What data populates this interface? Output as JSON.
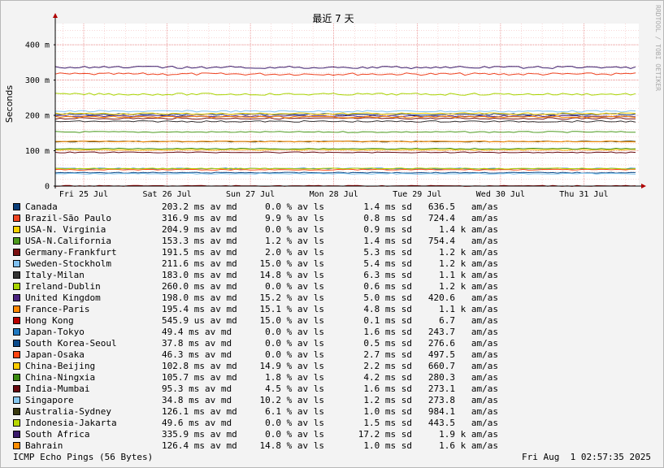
{
  "chart_data": {
    "type": "line",
    "title": "最近 7 天",
    "ylabel": "Seconds",
    "ylim": [
      0,
      0.46
    ],
    "y_ticks": [
      {
        "value": 0,
        "label": "0"
      },
      {
        "value": 0.1,
        "label": "100 m"
      },
      {
        "value": 0.2,
        "label": "200 m"
      },
      {
        "value": 0.3,
        "label": "300 m"
      },
      {
        "value": 0.4,
        "label": "400 m"
      }
    ],
    "x_ticks": [
      "Fri 25 Jul",
      "Sat 26 Jul",
      "Sun 27 Jul",
      "Mon 28 Jul",
      "Tue 29 Jul",
      "Wed 30 Jul",
      "Thu 31 Jul"
    ],
    "watermark": "RRDTOOL / TOBI OETIKER",
    "series": [
      {
        "name": "Canada",
        "color": "#0a3d78",
        "values": [
          0.203
        ]
      },
      {
        "name": "Brazil-São Paulo",
        "color": "#ee4422",
        "values": [
          0.317
        ]
      },
      {
        "name": "USA-N. Virginia",
        "color": "#f5d000",
        "values": [
          0.205
        ]
      },
      {
        "name": "USA-N.California",
        "color": "#4d9a1e",
        "values": [
          0.153
        ]
      },
      {
        "name": "Germany-Frankfurt",
        "color": "#7a0f0f",
        "values": [
          0.1915
        ]
      },
      {
        "name": "Sweden-Stockholm",
        "color": "#7fc0f0",
        "values": [
          0.2116
        ]
      },
      {
        "name": "Italy-Milan",
        "color": "#333333",
        "values": [
          0.183
        ]
      },
      {
        "name": "Ireland-Dublin",
        "color": "#a8d400",
        "values": [
          0.26
        ]
      },
      {
        "name": "United Kingdom",
        "color": "#4b2380",
        "values": [
          0.198
        ]
      },
      {
        "name": "France-Paris",
        "color": "#ff8800",
        "values": [
          0.1954
        ]
      },
      {
        "name": "Hong Kong",
        "color": "#b80000",
        "values": [
          0.000546
        ]
      },
      {
        "name": "Japan-Tokyo",
        "color": "#1f78c0",
        "values": [
          0.0494
        ]
      },
      {
        "name": "South Korea-Seoul",
        "color": "#0a4a8a",
        "values": [
          0.0378
        ]
      },
      {
        "name": "Japan-Osaka",
        "color": "#ff4411",
        "values": [
          0.0463
        ]
      },
      {
        "name": "China-Beijing",
        "color": "#ffcc00",
        "values": [
          0.1028
        ]
      },
      {
        "name": "China-Ningxia",
        "color": "#3a8a10",
        "values": [
          0.1057
        ]
      },
      {
        "name": "India-Mumbai",
        "color": "#6a0a10",
        "values": [
          0.0953
        ]
      },
      {
        "name": "Singapore",
        "color": "#88c8f0",
        "values": [
          0.0348
        ]
      },
      {
        "name": "Australia-Sydney",
        "color": "#3a3a10",
        "values": [
          0.1261
        ]
      },
      {
        "name": "Indonesia-Jakarta",
        "color": "#b8d800",
        "values": [
          0.0496
        ]
      },
      {
        "name": "South Africa",
        "color": "#3a1a6a",
        "values": [
          0.3359
        ]
      },
      {
        "name": "Bahrain",
        "color": "#ff8c00",
        "values": [
          0.1264
        ]
      }
    ]
  },
  "legend": [
    {
      "name": "Canada",
      "avg": "203.2 ms av md",
      "loss": "0.0 % av ls",
      "sd": "1.4 ms sd",
      "amas": "636.5   am/as"
    },
    {
      "name": "Brazil-São Paulo",
      "avg": "316.9 ms av md",
      "loss": "9.9 % av ls",
      "sd": "0.8 ms sd",
      "amas": "724.4   am/as"
    },
    {
      "name": "USA-N. Virginia",
      "avg": "204.9 ms av md",
      "loss": "0.0 % av ls",
      "sd": "0.9 ms sd",
      "amas": "1.4 k am/as"
    },
    {
      "name": "USA-N.California",
      "avg": "153.3 ms av md",
      "loss": "1.2 % av ls",
      "sd": "1.4 ms sd",
      "amas": "754.4   am/as"
    },
    {
      "name": "Germany-Frankfurt",
      "avg": "191.5 ms av md",
      "loss": "2.0 % av ls",
      "sd": "5.3 ms sd",
      "amas": "1.2 k am/as"
    },
    {
      "name": "Sweden-Stockholm",
      "avg": "211.6 ms av md",
      "loss": "15.0 % av ls",
      "sd": "5.4 ms sd",
      "amas": "1.2 k am/as"
    },
    {
      "name": "Italy-Milan",
      "avg": "183.0 ms av md",
      "loss": "14.8 % av ls",
      "sd": "6.3 ms sd",
      "amas": "1.1 k am/as"
    },
    {
      "name": "Ireland-Dublin",
      "avg": "260.0 ms av md",
      "loss": "0.0 % av ls",
      "sd": "0.6 ms sd",
      "amas": "1.2 k am/as"
    },
    {
      "name": "United Kingdom",
      "avg": "198.0 ms av md",
      "loss": "15.2 % av ls",
      "sd": "5.0 ms sd",
      "amas": "420.6   am/as"
    },
    {
      "name": "France-Paris",
      "avg": "195.4 ms av md",
      "loss": "15.1 % av ls",
      "sd": "4.8 ms sd",
      "amas": "1.1 k am/as"
    },
    {
      "name": "Hong Kong",
      "avg": "545.9 us av md",
      "loss": "15.0 % av ls",
      "sd": "0.1 ms sd",
      "amas": "6.7   am/as"
    },
    {
      "name": "Japan-Tokyo",
      "avg": "49.4 ms av md",
      "loss": "0.0 % av ls",
      "sd": "1.6 ms sd",
      "amas": "243.7   am/as"
    },
    {
      "name": "South Korea-Seoul",
      "avg": "37.8 ms av md",
      "loss": "0.0 % av ls",
      "sd": "0.5 ms sd",
      "amas": "276.6   am/as"
    },
    {
      "name": "Japan-Osaka",
      "avg": "46.3 ms av md",
      "loss": "0.0 % av ls",
      "sd": "2.7 ms sd",
      "amas": "497.5   am/as"
    },
    {
      "name": "China-Beijing",
      "avg": "102.8 ms av md",
      "loss": "14.9 % av ls",
      "sd": "2.2 ms sd",
      "amas": "660.7   am/as"
    },
    {
      "name": "China-Ningxia",
      "avg": "105.7 ms av md",
      "loss": "1.8 % av ls",
      "sd": "4.2 ms sd",
      "amas": "280.3   am/as"
    },
    {
      "name": "India-Mumbai",
      "avg": "95.3 ms av md",
      "loss": "4.5 % av ls",
      "sd": "1.6 ms sd",
      "amas": "273.1   am/as"
    },
    {
      "name": "Singapore",
      "avg": "34.8 ms av md",
      "loss": "10.2 % av ls",
      "sd": "1.2 ms sd",
      "amas": "273.8   am/as"
    },
    {
      "name": "Australia-Sydney",
      "avg": "126.1 ms av md",
      "loss": "6.1 % av ls",
      "sd": "1.0 ms sd",
      "amas": "984.1   am/as"
    },
    {
      "name": "Indonesia-Jakarta",
      "avg": "49.6 ms av md",
      "loss": "0.0 % av ls",
      "sd": "1.5 ms sd",
      "amas": "443.5   am/as"
    },
    {
      "name": "South Africa",
      "avg": "335.9 ms av md",
      "loss": "0.0 % av ls",
      "sd": "17.2 ms sd",
      "amas": "1.9 k am/as"
    },
    {
      "name": "Bahrain",
      "avg": "126.4 ms av md",
      "loss": "14.8 % av ls",
      "sd": "1.0 ms sd",
      "amas": "1.6 k am/as"
    }
  ],
  "footer": {
    "left": "ICMP Echo Pings (56 Bytes)",
    "right": "Fri Aug  1 02:57:35 2025"
  }
}
